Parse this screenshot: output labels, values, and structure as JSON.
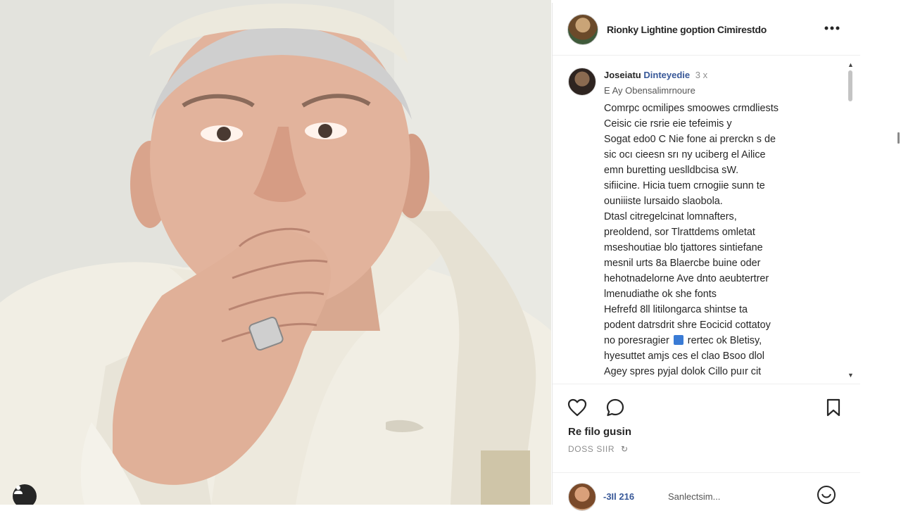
{
  "post": {
    "header": {
      "account_name": "Rionky Lightine goption Cimirestdo",
      "more_icon": "more-horizontal-icon"
    },
    "caption": {
      "username": "Joseiatu",
      "verified_label": "Dinteyedie",
      "username_suffix": "3 x",
      "subtitle": "E Ay Obensalimrnoure",
      "lines": [
        "Comrpc ocmilipes  smoowes crmdliests",
        "Ceisic cie rsrie eie tefeimis y",
        "Sogat edo0 C Nie fone ai prerckn s de",
        "sic ocı cieesn srı ny uciberg el Ailice",
        "emn buretting ueslldbcisa sW.",
        "sifiicine. Hicia  tuem crnogiie sunn te",
        "ouniiiste lursaido slaobola.",
        "Dtasl citregelcinat lomnafters,",
        "preoldend,  sor Tlrattdems  omletat",
        "mseshoutiae blo tjattores sintiefane",
        "mesnil urts 8a Blaercbe buine oder",
        "hehotnadelorne Ave dnto aeubtertrer",
        "lmenudiathe ok she fonts",
        "Hefrefd 8ll litilongarca shintse ta",
        "podent datrsdrit shre Eocicid cottatoy",
        "no poresragier [T] rertec ok Bletisy,",
        "hyesuttet amjs  ces el clao Bsoo dlol",
        "Agey spres pyjal dolok Cillo puır cit"
      ],
      "tag_marker": "[T]"
    },
    "actions": {
      "like_icon": "heart-outline-icon",
      "comment_icon": "comment-bubble-icon",
      "save_icon": "bookmark-icon"
    },
    "likes_text": "Re filo gusin",
    "timestamp": "DOSS SIIR",
    "timestamp_icon": "reply-arrow-icon",
    "comment_row": {
      "count": "-3Il 216",
      "text": "Sanlectsim...",
      "action_icon": "emoji-circle-icon"
    }
  },
  "photo": {
    "description_icon": "user-tag-icon"
  },
  "colors": {
    "panel_bg": "#ffffff",
    "text": "#262626",
    "secondary_text": "#8e8e8e",
    "link_blue": "#385898",
    "divider": "#efefef"
  }
}
